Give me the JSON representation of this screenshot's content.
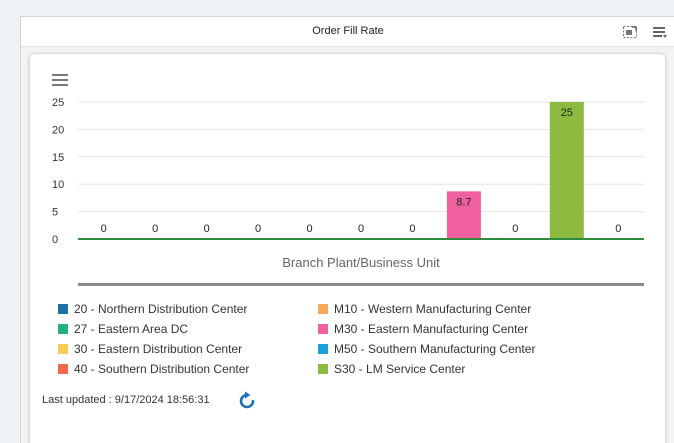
{
  "header": {
    "title": "Order Fill Rate"
  },
  "icons": {
    "expand": "expand-icon",
    "options": "list-options-icon",
    "menu": "hamburger-menu-icon",
    "refresh": "refresh-icon"
  },
  "chart_data": {
    "type": "bar",
    "xlabel": "Branch Plant/Business Unit",
    "ylim": [
      0,
      25
    ],
    "yticks": [
      0,
      5,
      10,
      15,
      20,
      25
    ],
    "series": [
      {
        "name": "20 - Northern Distribution Center",
        "color": "#1f6fa5",
        "value": 0
      },
      {
        "name": "27 - Eastern Area DC",
        "color": "#25b07a",
        "value": 0
      },
      {
        "name": "30 - Eastern Distribution Center",
        "color": "#f7cc5a",
        "value": 0
      },
      {
        "name": "40 - Southern Distribution Center",
        "color": "#f26949",
        "value": 0
      },
      {
        "name": "M10 - Western Manufacturing Center",
        "color": "#f7a85a",
        "value": 0
      },
      {
        "name": "M30 - Eastern Manufacturing Center",
        "color": "#f0609e",
        "value": 8.7
      },
      {
        "name": "M50 - Southern Manufacturing Center",
        "color": "#1aa3d9",
        "value": 0
      },
      {
        "name": "S30 - LM Service Center",
        "color": "#8dbb3f",
        "value": 25
      }
    ],
    "bar_slots": [
      {
        "label": "0",
        "value": 0,
        "color": ""
      },
      {
        "label": "0",
        "value": 0,
        "color": ""
      },
      {
        "label": "0",
        "value": 0,
        "color": ""
      },
      {
        "label": "0",
        "value": 0,
        "color": ""
      },
      {
        "label": "0",
        "value": 0,
        "color": ""
      },
      {
        "label": "0",
        "value": 0,
        "color": ""
      },
      {
        "label": "0",
        "value": 0,
        "color": ""
      },
      {
        "label": "8.7",
        "value": 8.7,
        "color": "#f0609e"
      },
      {
        "label": "0",
        "value": 0,
        "color": ""
      },
      {
        "label": "25",
        "value": 25,
        "color": "#8dbb3f"
      },
      {
        "label": "0",
        "value": 0,
        "color": ""
      }
    ]
  },
  "footer": {
    "last_updated": "Last updated : 9/17/2024 18:56:31"
  }
}
